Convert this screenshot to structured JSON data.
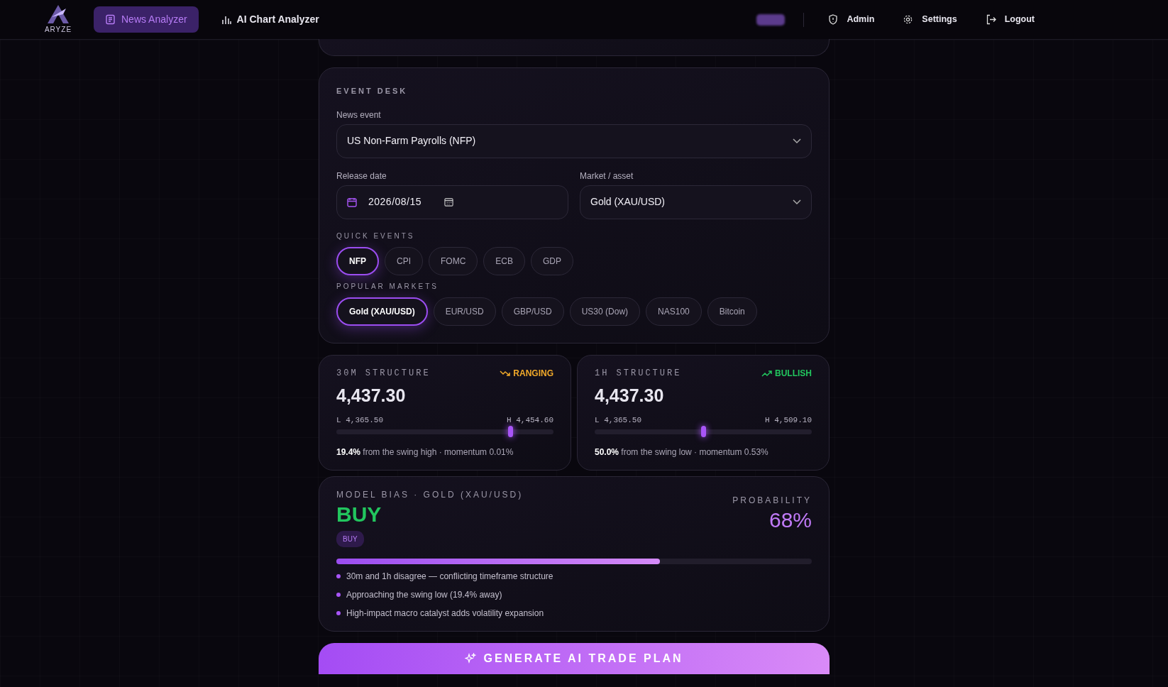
{
  "nav": {
    "logo_text": "ARYZE",
    "tabs": [
      {
        "label": "News Analyzer",
        "selected": true
      },
      {
        "label": "AI Chart Analyzer",
        "selected": false
      }
    ],
    "actions": [
      {
        "label": "Admin"
      },
      {
        "label": "Settings"
      },
      {
        "label": "Logout"
      }
    ]
  },
  "event_desk": {
    "title": "EVENT DESK",
    "news_event": {
      "label": "News event",
      "value": "US Non-Farm Payrolls (NFP)"
    },
    "release_date": {
      "label": "Release date",
      "value": "2026/08/15"
    },
    "market": {
      "label": "Market / asset",
      "value": "Gold (XAU/USD)"
    },
    "quick_events": {
      "title": "QUICK EVENTS",
      "items": [
        {
          "label": "NFP",
          "selected": true
        },
        {
          "label": "CPI",
          "selected": false
        },
        {
          "label": "FOMC",
          "selected": false
        },
        {
          "label": "ECB",
          "selected": false
        },
        {
          "label": "GDP",
          "selected": false
        }
      ]
    },
    "popular_markets": {
      "title": "POPULAR MARKETS",
      "items": [
        {
          "label": "Gold (XAU/USD)",
          "selected": true
        },
        {
          "label": "EUR/USD",
          "selected": false
        },
        {
          "label": "GBP/USD",
          "selected": false
        },
        {
          "label": "US30 (Dow)",
          "selected": false
        },
        {
          "label": "NAS100",
          "selected": false
        },
        {
          "label": "Bitcoin",
          "selected": false
        }
      ]
    }
  },
  "structures": [
    {
      "title": "30M STRUCTURE",
      "kind": "ranging",
      "trend": "RANGING",
      "price": "4,437.30",
      "low": "L 4,365.50",
      "high": "H 4,454.60",
      "level": 0.8,
      "note": "**19.4%** from the swing high · momentum 0.01%"
    },
    {
      "title": "1H STRUCTURE",
      "kind": "bullish",
      "trend": "BULLISH",
      "price": "4,437.30",
      "low": "L 4,365.50",
      "high": "H 4,509.10",
      "level": 0.5,
      "note": "**50.0%** from the swing low · momentum 0.53%"
    }
  ],
  "bias": {
    "title": "MODEL BIAS · GOLD (XAU/USD)",
    "kind": "buy",
    "signal": "BUY",
    "badge": "BUY",
    "probability_label": "PROBABILITY",
    "probability": "68%",
    "level": 0.68,
    "reasons": [
      "30m and 1h disagree — conflicting timeframe structure",
      "Approaching the swing low (19.4% away)",
      "High-impact macro catalyst adds volatility expansion"
    ]
  },
  "generate_button": "GENERATE AI TRADE PLAN"
}
